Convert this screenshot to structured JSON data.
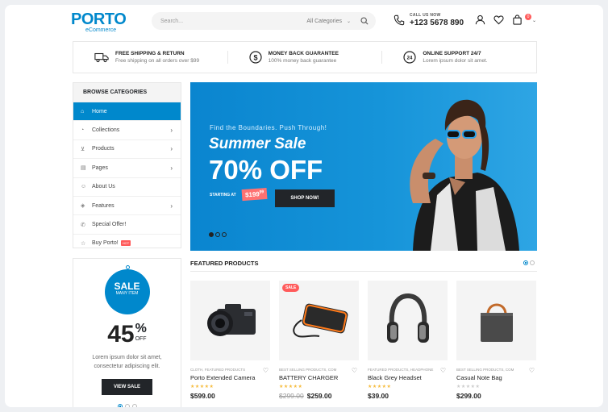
{
  "header": {
    "logo": "PORTO",
    "logo_sub": "eCommerce",
    "search_placeholder": "Search...",
    "search_category": "All Categories",
    "call_label": "CALL US NOW",
    "call_number": "+123 5678 890",
    "cart_count": "0"
  },
  "infobar": [
    {
      "title": "FREE SHIPPING & RETURN",
      "desc": "Free shipping on all orders over $99",
      "icon": "truck-icon"
    },
    {
      "title": "MONEY BACK GUARANTEE",
      "desc": "100% money back guarantee",
      "icon": "dollar-icon"
    },
    {
      "title": "ONLINE SUPPORT 24/7",
      "desc": "Lorem ipsum dolor sit amet.",
      "icon": "support-24-icon"
    }
  ],
  "categories": {
    "heading": "BROWSE CATEGORIES",
    "items": [
      {
        "label": "Home",
        "icon": "home-icon"
      },
      {
        "label": "Collections",
        "icon": "collections-icon"
      },
      {
        "label": "Products",
        "icon": "cart-icon"
      },
      {
        "label": "Pages",
        "icon": "pages-icon"
      },
      {
        "label": "About Us",
        "icon": "users-icon"
      },
      {
        "label": "Features",
        "icon": "features-icon"
      },
      {
        "label": "Special Offer!",
        "icon": "phone-icon"
      },
      {
        "label": "Buy Porto!",
        "icon": "star-icon",
        "badge": "HOT"
      }
    ]
  },
  "sale_box": {
    "sale": "SALE",
    "many": "MANY ITEM",
    "percent": "45",
    "percent_sign": "%",
    "off": "OFF",
    "desc_line1": "Lorem ipsum dolor sit amet,",
    "desc_line2": "consectetur adipiscing elit.",
    "button": "VIEW SALE"
  },
  "banner": {
    "tagline": "Find the Boundaries. Push Through!",
    "title": "Summer Sale",
    "discount": "70% OFF",
    "starting_at": "STARTING AT",
    "price": "$199",
    "price_cents": "99",
    "button": "SHOP NOW!"
  },
  "featured": {
    "title": "FEATURED PRODUCTS",
    "products": [
      {
        "category": "CLOTH, FEATURED PRODUCTS",
        "name": "Porto Extended Camera",
        "price": "$599.00",
        "old_price": "",
        "rating": 5,
        "sale": ""
      },
      {
        "category": "BEST SELLING PRODUCTS, COM",
        "name": "BATTERY CHARGER",
        "price": "$259.00",
        "old_price": "$299.00",
        "rating": 5,
        "sale": "SALE"
      },
      {
        "category": "FEATURED PRODUCTS, HEADPHONE",
        "name": "Black Grey Headset",
        "price": "$39.00",
        "old_price": "",
        "rating": 5,
        "sale": ""
      },
      {
        "category": "BEST SELLING PRODUCTS, COM",
        "name": "Casual Note Bag",
        "price": "$299.00",
        "old_price": "",
        "rating": 0,
        "sale": ""
      }
    ]
  },
  "colors": {
    "primary": "#0088cc",
    "dark": "#222529",
    "sale": "#ff5b5b",
    "star": "#f6bc3e"
  }
}
